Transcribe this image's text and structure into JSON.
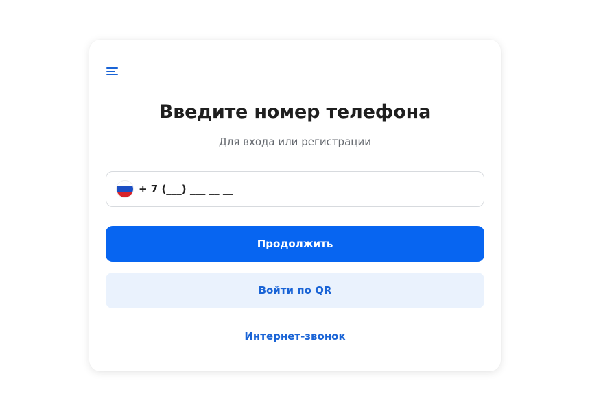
{
  "header": {
    "menu_icon": "menu-icon"
  },
  "title": "Введите номер телефона",
  "subtitle": "Для входа или регистрации",
  "phone": {
    "flag_icon": "russia-flag-icon",
    "value": "+ 7 (___) ___ __ __"
  },
  "actions": {
    "continue_label": "Продолжить",
    "qr_label": "Войти по QR",
    "internet_call_label": "Интернет-звонок"
  },
  "colors": {
    "primary": "#0765f1",
    "secondary_bg": "#eaf2fd",
    "link": "#1a64d6"
  }
}
